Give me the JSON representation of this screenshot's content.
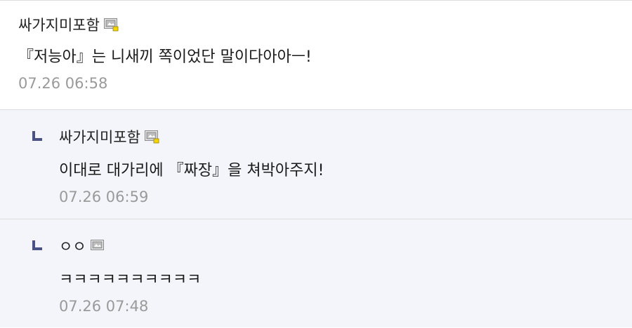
{
  "comments": [
    {
      "author": "싸가지미포함",
      "text": "『저능아』는 니새끼 쪽이었단 말이다아아ㅡ!",
      "time": "07.26 06:58",
      "has_image": true
    },
    {
      "author": "싸가지미포함",
      "text": "이대로 대가리에 『짜장』을 쳐박아주지!",
      "time": "07.26 06:59",
      "has_image": true
    },
    {
      "author": "ㅇㅇ",
      "text": "ㅋㅋㅋㅋㅋㅋㅋㅋㅋㅋ",
      "time": "07.26 07:48",
      "has_image": false
    }
  ],
  "colors": {
    "reply_background": "#f4f5fa",
    "reply_arrow": "#4a5285",
    "timestamp": "#9a9a9a",
    "divider": "#dcdcdc"
  },
  "icons": {
    "image_attachment": "image-attachment-icon",
    "reply": "reply-arrow-icon"
  }
}
